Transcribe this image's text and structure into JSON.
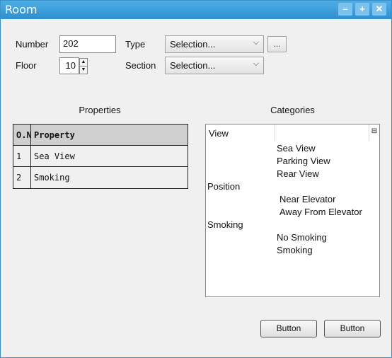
{
  "window": {
    "title": "Room",
    "min_glyph": "–",
    "max_glyph": "+",
    "close_glyph": "✕"
  },
  "form": {
    "number_label": "Number",
    "number_value": "202",
    "floor_label": "Floor",
    "floor_value": "10",
    "type_label": "Type",
    "type_value": "Selection...",
    "section_label": "Section",
    "section_value": "Selection...",
    "browse_label": "..."
  },
  "properties": {
    "heading": "Properties",
    "columns": [
      "O.N",
      "Property"
    ],
    "rows": [
      {
        "no": "1",
        "property": "Sea View"
      },
      {
        "no": "2",
        "property": "Smoking"
      }
    ]
  },
  "categories": {
    "heading": "Categories",
    "header_col": "View",
    "groups": [
      {
        "name": "View",
        "items": [
          "Sea View",
          "Parking View",
          "Rear View"
        ]
      },
      {
        "name": "Position",
        "items": [
          "Near Elevator",
          "Away From Elevator"
        ]
      },
      {
        "name": "Smoking",
        "items": [
          "No Smoking",
          "Smoking"
        ]
      }
    ]
  },
  "buttons": {
    "button1": "Button",
    "button2": "Button"
  }
}
